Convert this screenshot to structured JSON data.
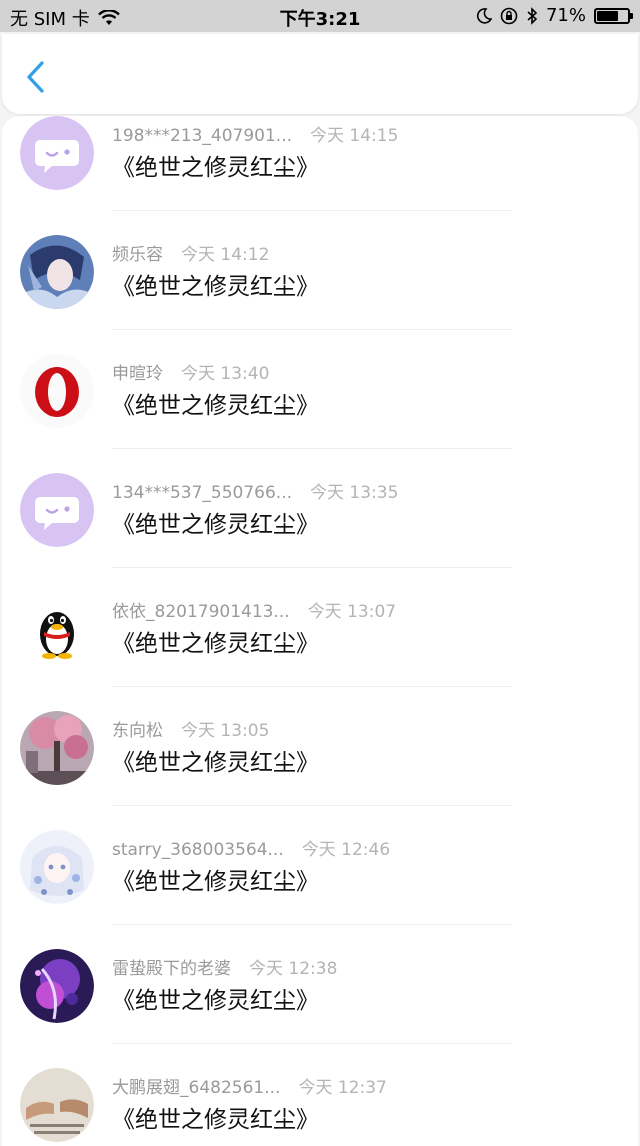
{
  "status_bar": {
    "carrier": "无 SIM 卡",
    "time": "下午3:21",
    "battery_percent": "71%",
    "battery_level": 0.71,
    "icons": [
      "wifi-icon",
      "moon-icon",
      "rotation-lock-icon",
      "bluetooth-icon",
      "battery-icon"
    ]
  },
  "nav": {
    "back_icon": "chevron-left-icon",
    "accent_color": "#2fa0e8"
  },
  "messages": [
    {
      "name": "198***213_407901...",
      "time": "今天 14:15",
      "text": "《绝世之修灵红尘》",
      "avatar": "default-chat-avatar"
    },
    {
      "name": "频乐容",
      "time": "今天 14:12",
      "text": "《绝世之修灵红尘》",
      "avatar": "anime-character-avatar"
    },
    {
      "name": "申暄玲",
      "time": "今天 13:40",
      "text": "《绝世之修灵红尘》",
      "avatar": "opera-logo-avatar"
    },
    {
      "name": "134***537_550766...",
      "time": "今天 13:35",
      "text": "《绝世之修灵红尘》",
      "avatar": "default-chat-avatar"
    },
    {
      "name": "依依_82017901413...",
      "time": "今天 13:07",
      "text": "《绝世之修灵红尘》",
      "avatar": "qq-penguin-avatar"
    },
    {
      "name": "东向松",
      "time": "今天 13:05",
      "text": "《绝世之修灵红尘》",
      "avatar": "blossom-tree-avatar"
    },
    {
      "name": "starry_368003564...",
      "time": "今天 12:46",
      "text": "《绝世之修灵红尘》",
      "avatar": "anime-girl-avatar"
    },
    {
      "name": "雷蛰殿下的老婆",
      "time": "今天 12:38",
      "text": "《绝世之修灵红尘》",
      "avatar": "purple-anime-avatar"
    },
    {
      "name": "大鹏展翅_6482561...",
      "time": "今天 12:37",
      "text": "《绝世之修灵红尘》",
      "avatar": "hands-text-avatar"
    }
  ]
}
